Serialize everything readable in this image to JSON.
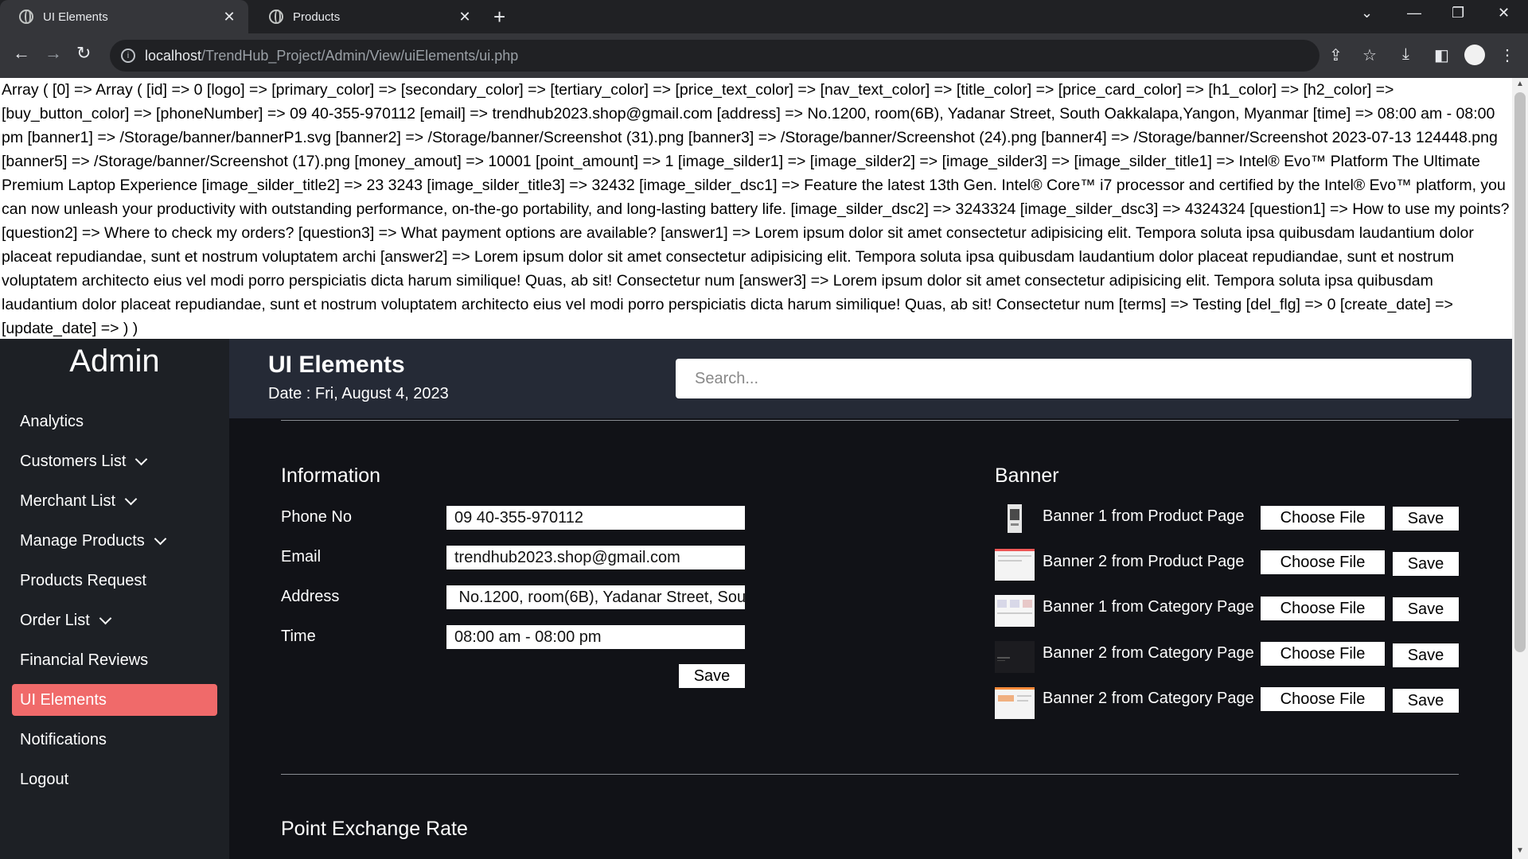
{
  "browser": {
    "tabs": [
      {
        "label": "UI Elements",
        "close": "✕"
      },
      {
        "label": "Products",
        "close": "✕"
      }
    ],
    "new_tab": "+",
    "url_host": "localhost",
    "url_path": "/TrendHub_Project/Admin/View/uiElements/ui.php",
    "icons": [
      "back-arrow-icon",
      "forward-arrow-icon",
      "reload-icon",
      "info-icon",
      "share-icon",
      "star-icon",
      "download-icon",
      "sidepanel-icon",
      "profile-icon",
      "menu-icon"
    ]
  },
  "dump_text": "Array ( [0] => Array ( [id] => 0 [logo] => [primary_color] => [secondary_color] => [tertiary_color] => [price_text_color] => [nav_text_color] => [title_color] => [price_card_color] => [h1_color] => [h2_color] => [buy_button_color] => [phoneNumber] => 09 40-355-970112 [email] => trendhub2023.shop@gmail.com [address] => No.1200, room(6B), Yadanar Street, South Oakkalapa,Yangon, Myanmar [time] => 08:00 am - 08:00 pm [banner1] => /Storage/banner/bannerP1.svg [banner2] => /Storage/banner/Screenshot (31).png [banner3] => /Storage/banner/Screenshot (24).png [banner4] => /Storage/banner/Screenshot 2023-07-13 124448.png [banner5] => /Storage/banner/Screenshot (17).png [money_amout] => 10001 [point_amount] => 1 [image_silder1] => [image_silder2] => [image_silder3] => [image_silder_title1] => Intel® Evo™ Platform The Ultimate Premium Laptop Experience [image_silder_title2] => 23 3243 [image_silder_title3] => 32432 [image_silder_dsc1] => Feature the latest 13th Gen. Intel® Core™ i7 processor and certified by the Intel® Evo™ platform, you can now unleash your productivity with outstanding performance, on-the-go portability, and long-lasting battery life. [image_silder_dsc2] => 3243324 [image_silder_dsc3] => 4324324 [question1] => How to use my points? [question2] => Where to check my orders? [question3] => What payment options are available? [answer1] => Lorem ipsum dolor sit amet consectetur adipisicing elit. Tempora soluta ipsa quibusdam laudantium dolor placeat repudiandae, sunt et nostrum voluptatem archi [answer2] => Lorem ipsum dolor sit amet consectetur adipisicing elit. Tempora soluta ipsa quibusdam laudantium dolor placeat repudiandae, sunt et nostrum voluptatem architecto eius vel modi porro perspiciatis dicta harum similique! Quas, ab sit! Consectetur num [answer3] => Lorem ipsum dolor sit amet consectetur adipisicing elit. Tempora soluta ipsa quibusdam laudantium dolor placeat repudiandae, sunt et nostrum voluptatem architecto eius vel modi porro perspiciatis dicta harum similique! Quas, ab sit! Consectetur num [terms] => Testing [del_flg] => 0 [create_date] => [update_date] => ) )",
  "sidebar": {
    "brand": "Admin",
    "items": [
      {
        "label": "Analytics"
      },
      {
        "label": "Customers List"
      },
      {
        "label": "Merchant List"
      },
      {
        "label": "Manage Products"
      },
      {
        "label": "Products Request"
      },
      {
        "label": "Order List"
      },
      {
        "label": "Financial Reviews"
      },
      {
        "label": "UI Elements"
      },
      {
        "label": "Notifications"
      },
      {
        "label": "Logout"
      }
    ]
  },
  "header": {
    "title": "UI Elements",
    "date": "Date : Fri, August 4, 2023",
    "search_placeholder": "Search..."
  },
  "information": {
    "title": "Information",
    "fields": [
      {
        "label": "Phone No",
        "value": "09 40-355-970112"
      },
      {
        "label": "Email",
        "value": "trendhub2023.shop@gmail.com"
      },
      {
        "label": "Address",
        "value": " No.1200, room(6B), Yadanar Street, South Oakkalapa,Yangon, Myanmar"
      },
      {
        "label": "Time",
        "value": "08:00 am - 08:00 pm"
      }
    ],
    "save_label": "Save"
  },
  "banner": {
    "title": "Banner",
    "choose_label": "Choose File",
    "save_label": "Save",
    "items": [
      {
        "label": "Banner 1 from Product Page"
      },
      {
        "label": "Banner 2 from Product Page"
      },
      {
        "label": "Banner 1 from Category Page"
      },
      {
        "label": "Banner 2 from Category Page"
      },
      {
        "label": "Banner 2 from Category Page"
      }
    ]
  },
  "point_exchange": {
    "title": "Point Exchange Rate"
  },
  "colors": {
    "sidebar_bg": "#1d2025",
    "main_bg": "#111217",
    "header_bg": "#252a36",
    "active_accent": "#f06a6a"
  }
}
